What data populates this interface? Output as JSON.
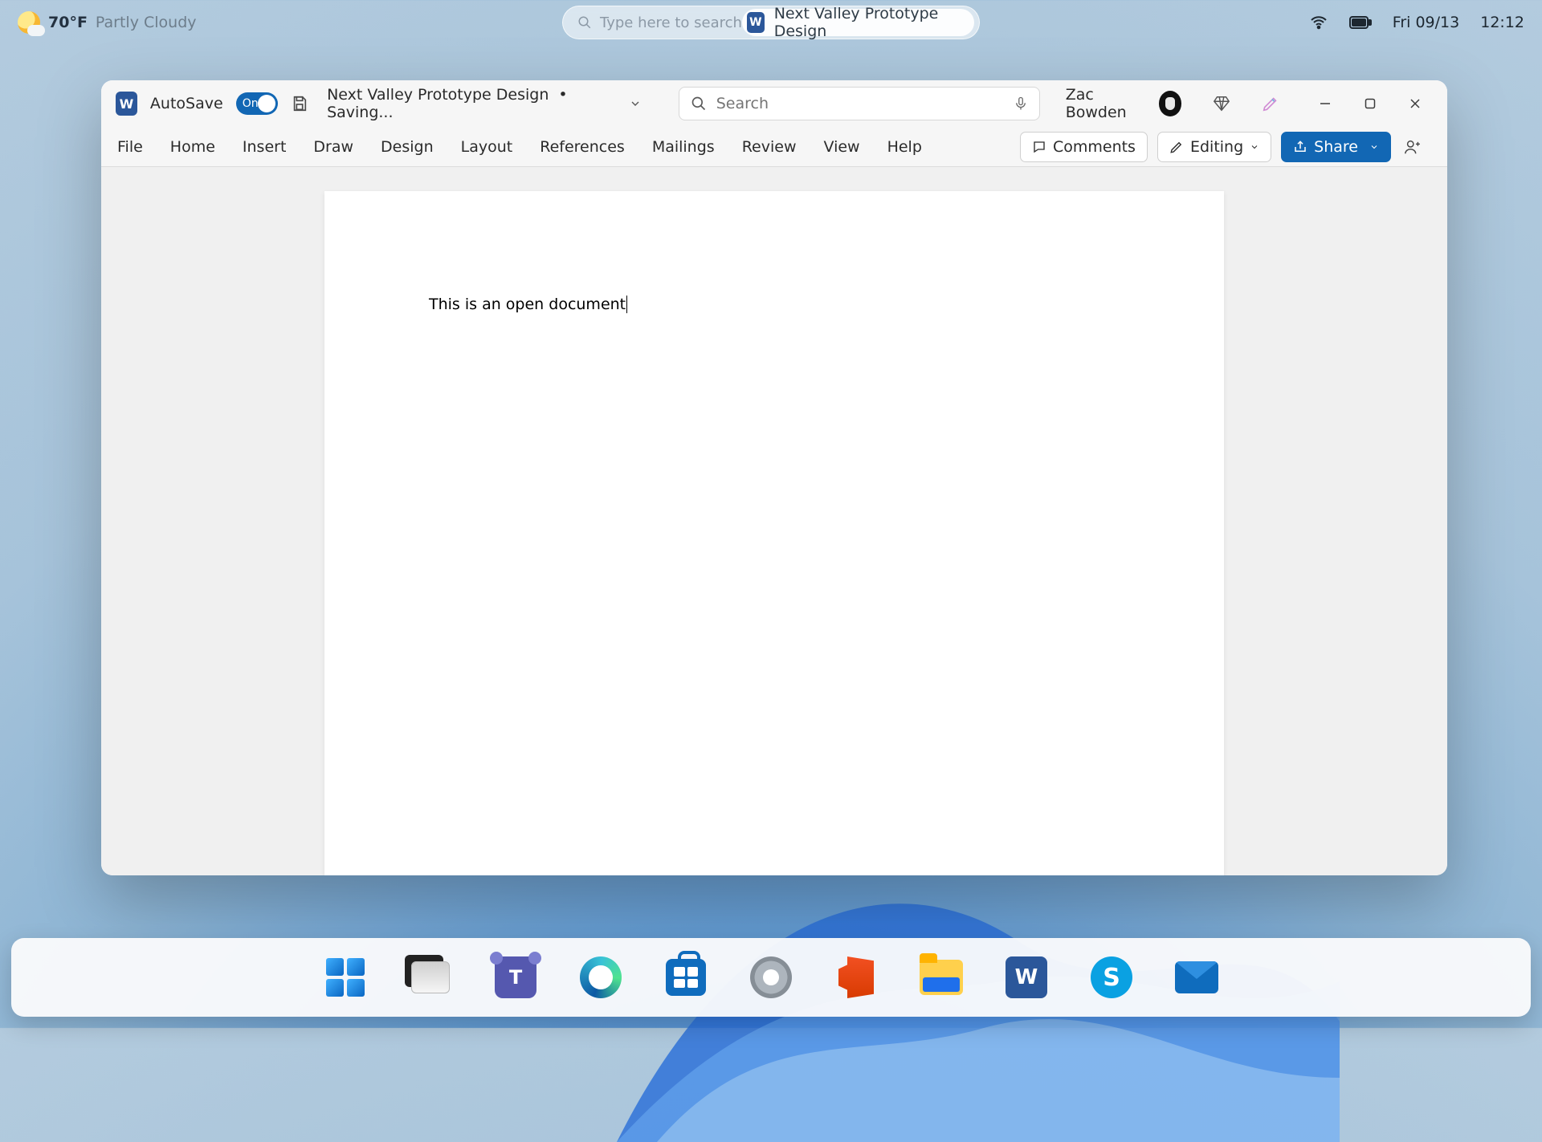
{
  "topbar": {
    "temp": "70°F",
    "weather_desc": "Partly Cloudy",
    "search_placeholder": "Type here to search",
    "suggestion_label": "Next Valley Prototype Design",
    "date": "Fri 09/13",
    "time": "12:12"
  },
  "window": {
    "autosave_label": "AutoSave",
    "autosave_state": "On",
    "doc_name": "Next Valley Prototype Design",
    "doc_status": "Saving...",
    "search_placeholder": "Search",
    "user_name": "Zac Bowden",
    "tabs": [
      "File",
      "Home",
      "Insert",
      "Draw",
      "Design",
      "Layout",
      "References",
      "Mailings",
      "Review",
      "View",
      "Help"
    ],
    "comments_label": "Comments",
    "editing_label": "Editing",
    "share_label": "Share",
    "document_body": "This is an open document"
  },
  "taskbar": {
    "items": [
      "start",
      "task-view",
      "teams",
      "edge",
      "store",
      "settings",
      "office",
      "file-explorer",
      "word",
      "skype",
      "mail"
    ]
  }
}
